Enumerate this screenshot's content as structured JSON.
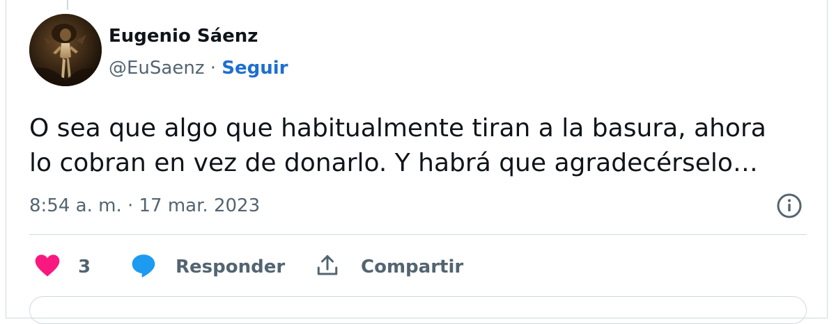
{
  "author": {
    "name": "Eugenio Sáenz",
    "handle": "@EuSaenz",
    "separator": "·",
    "follow_label": "Seguir",
    "avatar": "avatar-painting"
  },
  "tweet": {
    "lines": [
      "O sea que algo que habitualmente tiran a la basura, ahora",
      "lo cobran en vez de donarlo. Y habrá que agradecérselo…"
    ],
    "timestamp": "8:54 a. m. · 17 mar. 2023"
  },
  "actions": {
    "like_count": "3",
    "reply_label": "Responder",
    "share_label": "Compartir"
  },
  "icons": {
    "like": "heart-icon",
    "reply": "speech-bubble-icon",
    "share": "upload-icon",
    "info": "info-icon"
  },
  "colors": {
    "like": "#f91880",
    "reply": "#1d9bf0",
    "link": "#1d6fd0",
    "secondary_text": "#536471",
    "border": "#cfd9de"
  }
}
